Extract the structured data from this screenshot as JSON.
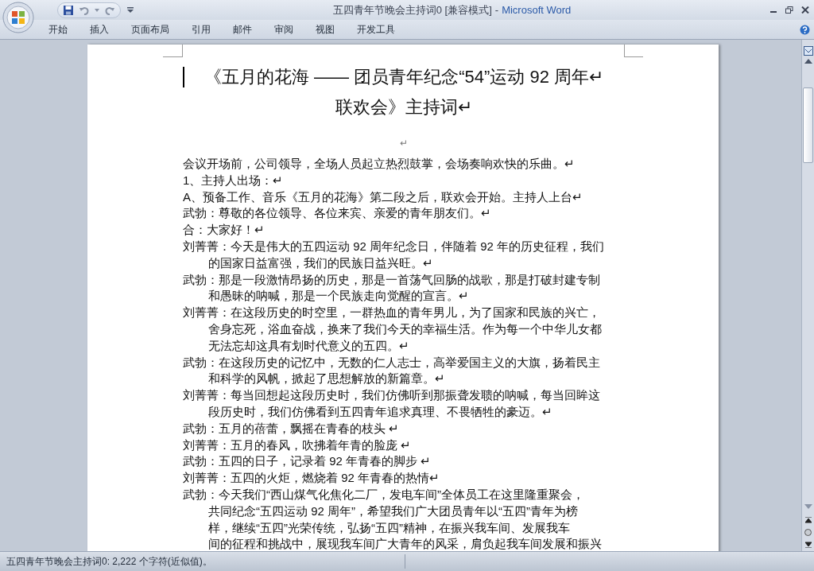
{
  "window": {
    "title": "五四青年节晚会主持词0 [兼容模式]",
    "title_separator": "-",
    "app_name": "Microsoft Word"
  },
  "ribbon_tabs": [
    {
      "label": "开始"
    },
    {
      "label": "插入"
    },
    {
      "label": "页面布局"
    },
    {
      "label": "引用"
    },
    {
      "label": "邮件"
    },
    {
      "label": "审阅"
    },
    {
      "label": "视图"
    },
    {
      "label": "开发工具"
    }
  ],
  "document": {
    "title_lines": [
      "《五月的花海 —— 团员青年纪念“54”运动 92 周年↵",
      "联欢会》主持词↵"
    ],
    "blank_mark": "↵",
    "paragraphs": [
      {
        "lines": [
          "会议开场前，公司领导，全场人员起立热烈鼓掌，会场奏响欢快的乐曲。↵"
        ]
      },
      {
        "lines": [
          "1、主持人出场：↵"
        ]
      },
      {
        "lines": [
          "A、预备工作、音乐《五月的花海》第二段之后，联欢会开始。主持人上台↵"
        ]
      },
      {
        "lines": [
          "武勃：尊敬的各位领导、各位来宾、亲爱的青年朋友们。↵"
        ]
      },
      {
        "lines": [
          "合：大家好！↵"
        ]
      },
      {
        "lines": [
          "刘菁菁：今天是伟大的五四运动 92 周年纪念日，伴随着 92 年的历史征程，我们",
          "的国家日益富强，我们的民族日益兴旺。↵"
        ]
      },
      {
        "lines": [
          "武勃：那是一段激情昂扬的历史，那是一首荡气回肠的战歌，那是打破封建专制",
          "和愚昧的呐喊，那是一个民族走向觉醒的宣言。↵"
        ]
      },
      {
        "lines": [
          "刘菁菁：在这段历史的时空里，一群热血的青年男儿，为了国家和民族的兴亡，",
          "舍身忘死，浴血奋战，换来了我们今天的幸福生活。作为每一个中华儿女都",
          "无法忘却这具有划时代意义的五四。↵"
        ]
      },
      {
        "lines": [
          "武勃：在这段历史的记忆中，无数的仁人志士，高举爱国主义的大旗，扬着民主",
          "和科学的风帆，掀起了思想解放的新篇章。↵"
        ]
      },
      {
        "lines": [
          "刘菁菁：每当回想起这段历史时，我们仿佛听到那振聋发聩的呐喊，每当回眸这",
          "段历史时，我们仿佛看到五四青年追求真理、不畏牺牲的豪迈。↵"
        ]
      },
      {
        "lines": [
          "武勃：五月的蓓蕾，飘摇在青春的枝头 ↵"
        ]
      },
      {
        "lines": [
          "刘菁菁：五月的春风，吹拂着年青的脸庞 ↵"
        ]
      },
      {
        "lines": [
          "武勃：五四的日子，记录着 92 年青春的脚步 ↵"
        ]
      },
      {
        "lines": [
          "刘菁菁：五四的火炬，燃烧着 92 年青春的热情↵"
        ]
      },
      {
        "lines": [
          "武勃：今天我们“西山煤气化焦化二厂，发电车间”全体员工在这里隆重聚会，",
          "共同纪念“五四运动 92 周年”，希望我们广大团员青年以“五四”青年为榜",
          "样，继续“五四”光荣传统，弘扬“五四”精神，在振兴我车间、发展我车",
          "间的征程和挑战中，展现我车间广大青年的风采，肩负起我车间发展和振兴"
        ]
      }
    ]
  },
  "status_bar": {
    "text": "五四青年节晚会主持词0: 2,222 个字符(近似值)。"
  }
}
